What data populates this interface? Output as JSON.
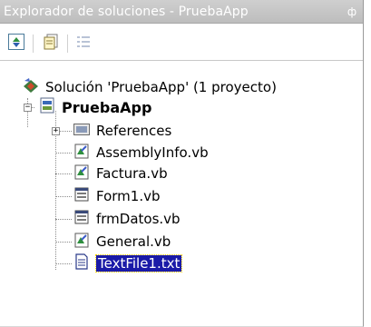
{
  "window": {
    "title": "Explorador de soluciones - PruebaApp",
    "pin_glyph": "ф"
  },
  "toolbar": {
    "buttons": [
      {
        "name": "refresh-icon"
      },
      {
        "name": "properties-icon"
      },
      {
        "name": "show-all-files-icon"
      }
    ]
  },
  "tree": {
    "solution": "Solución 'PruebaApp' (1 proyecto)",
    "project": "PruebaApp",
    "items": [
      {
        "label": "References",
        "icon": "references-folder-icon"
      },
      {
        "label": "AssemblyInfo.vb",
        "icon": "vb-module-icon"
      },
      {
        "label": "Factura.vb",
        "icon": "vb-module-icon"
      },
      {
        "label": "Form1.vb",
        "icon": "vb-form-icon"
      },
      {
        "label": "frmDatos.vb",
        "icon": "vb-form-icon"
      },
      {
        "label": "General.vb",
        "icon": "vb-module-icon"
      },
      {
        "label": "TextFile1.txt",
        "icon": "text-file-icon",
        "selected": true
      }
    ]
  },
  "colors": {
    "titlebar": "#c4c4c4",
    "selection": "#1a1aa8"
  }
}
